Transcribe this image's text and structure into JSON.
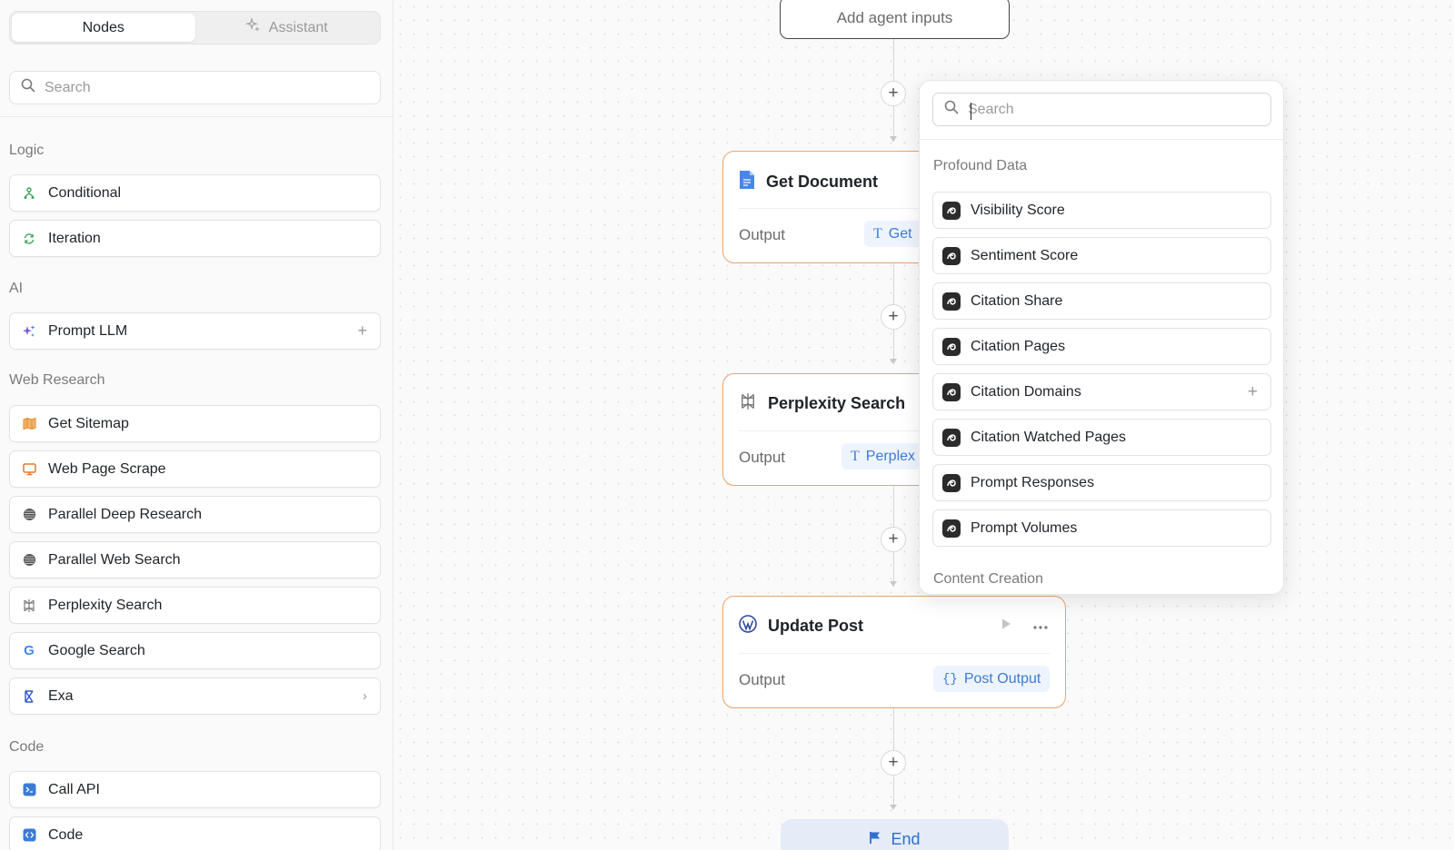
{
  "sidebar": {
    "tabs": [
      {
        "label": "Nodes"
      },
      {
        "label": "Assistant"
      }
    ],
    "search": {
      "placeholder": "Search"
    },
    "sections": {
      "logic": "Logic",
      "ai": "AI",
      "web_research": "Web Research",
      "code": "Code"
    },
    "items": {
      "conditional": "Conditional",
      "iteration": "Iteration",
      "prompt_llm": "Prompt LLM",
      "get_sitemap": "Get Sitemap",
      "web_page_scrape": "Web Page Scrape",
      "parallel_deep_research": "Parallel Deep Research",
      "parallel_web_search": "Parallel Web Search",
      "perplexity_search": "Perplexity Search",
      "google_search": "Google Search",
      "exa": "Exa",
      "call_api": "Call API",
      "code": "Code"
    }
  },
  "canvas": {
    "agent_inputs_label": "Add agent inputs",
    "nodes": {
      "get_document": {
        "title": "Get Document",
        "output_label": "Output",
        "output_chip": "Get"
      },
      "perplexity_search": {
        "title": "Perplexity Search",
        "output_label": "Output",
        "output_chip": "Perplex"
      },
      "update_post": {
        "title": "Update Post",
        "output_label": "Output",
        "output_chip": "Post Output"
      }
    },
    "end_label": "End"
  },
  "dropdown": {
    "search_placeholder": "Search",
    "section_profound": "Profound Data",
    "items": [
      "Visibility Score",
      "Sentiment Score",
      "Citation Share",
      "Citation Pages",
      "Citation Domains",
      "Citation Watched Pages",
      "Prompt Responses",
      "Prompt Volumes"
    ],
    "section_content": "Content Creation"
  },
  "colors": {
    "node_border": "#e9a36b",
    "chip_bg": "#eef4fd",
    "chip_text": "#3b7bd8",
    "end_bg": "#e5ecf7"
  }
}
